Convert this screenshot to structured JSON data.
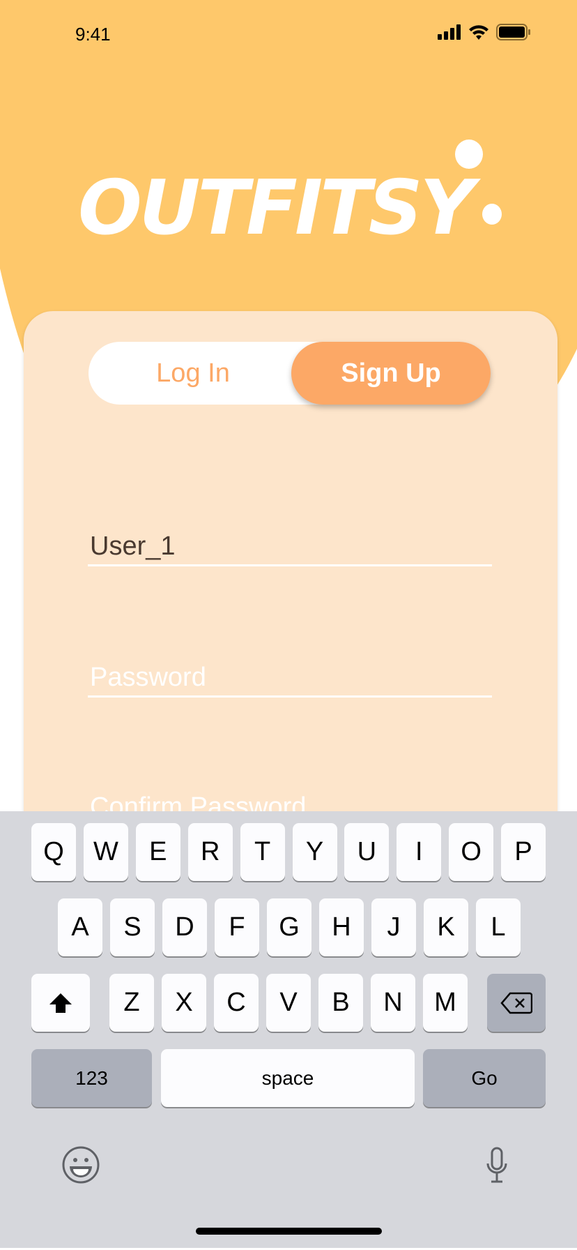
{
  "status_bar": {
    "time": "9:41"
  },
  "logo": "OUTFITSY",
  "tabs": {
    "login": "Log In",
    "signup": "Sign Up",
    "active": "signup"
  },
  "form": {
    "username_value": "User_1",
    "password_placeholder": "Password",
    "confirm_placeholder": "Confirm Password"
  },
  "keyboard": {
    "row1": [
      "Q",
      "W",
      "E",
      "R",
      "T",
      "Y",
      "U",
      "I",
      "O",
      "P"
    ],
    "row2": [
      "A",
      "S",
      "D",
      "F",
      "G",
      "H",
      "J",
      "K",
      "L"
    ],
    "row3": [
      "Z",
      "X",
      "C",
      "V",
      "B",
      "N",
      "M"
    ],
    "numbers": "123",
    "space": "space",
    "go": "Go"
  },
  "colors": {
    "brand_yellow": "#FEC86B",
    "accent_orange": "#FCA866",
    "card": "#FDE5CB"
  }
}
